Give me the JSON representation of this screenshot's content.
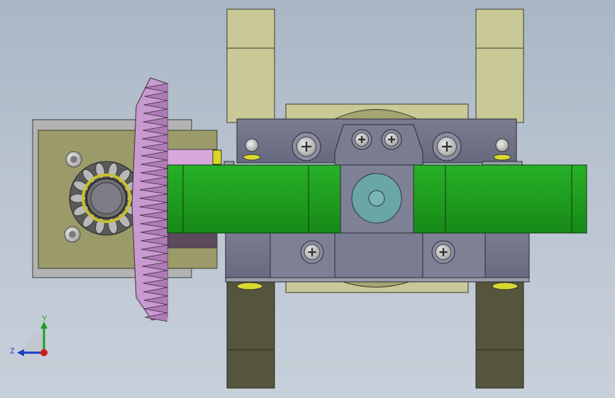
{
  "viewport": {
    "background_top": "#a9b6c4",
    "background_bottom": "#c8d0da"
  },
  "model": {
    "colors": {
      "bracket": "#c9c998",
      "bracket_dark": "#4f4f3a",
      "plate": "#9b9b6a",
      "plate_frame": "#b0b0b0",
      "body": "#6e7085",
      "body_light": "#8a8ca0",
      "green_block": "#1f9e1f",
      "gear_pink": "#c89ad0",
      "shaft_pink": "#d8a8dc",
      "screw": "#c8c8c8",
      "hub": "#6aa6a6"
    }
  },
  "triad": {
    "y_label": "Y",
    "z_label": "Z",
    "y_color": "#1aa01a",
    "z_color": "#1a3fbf",
    "origin_color": "#d01a1a"
  }
}
